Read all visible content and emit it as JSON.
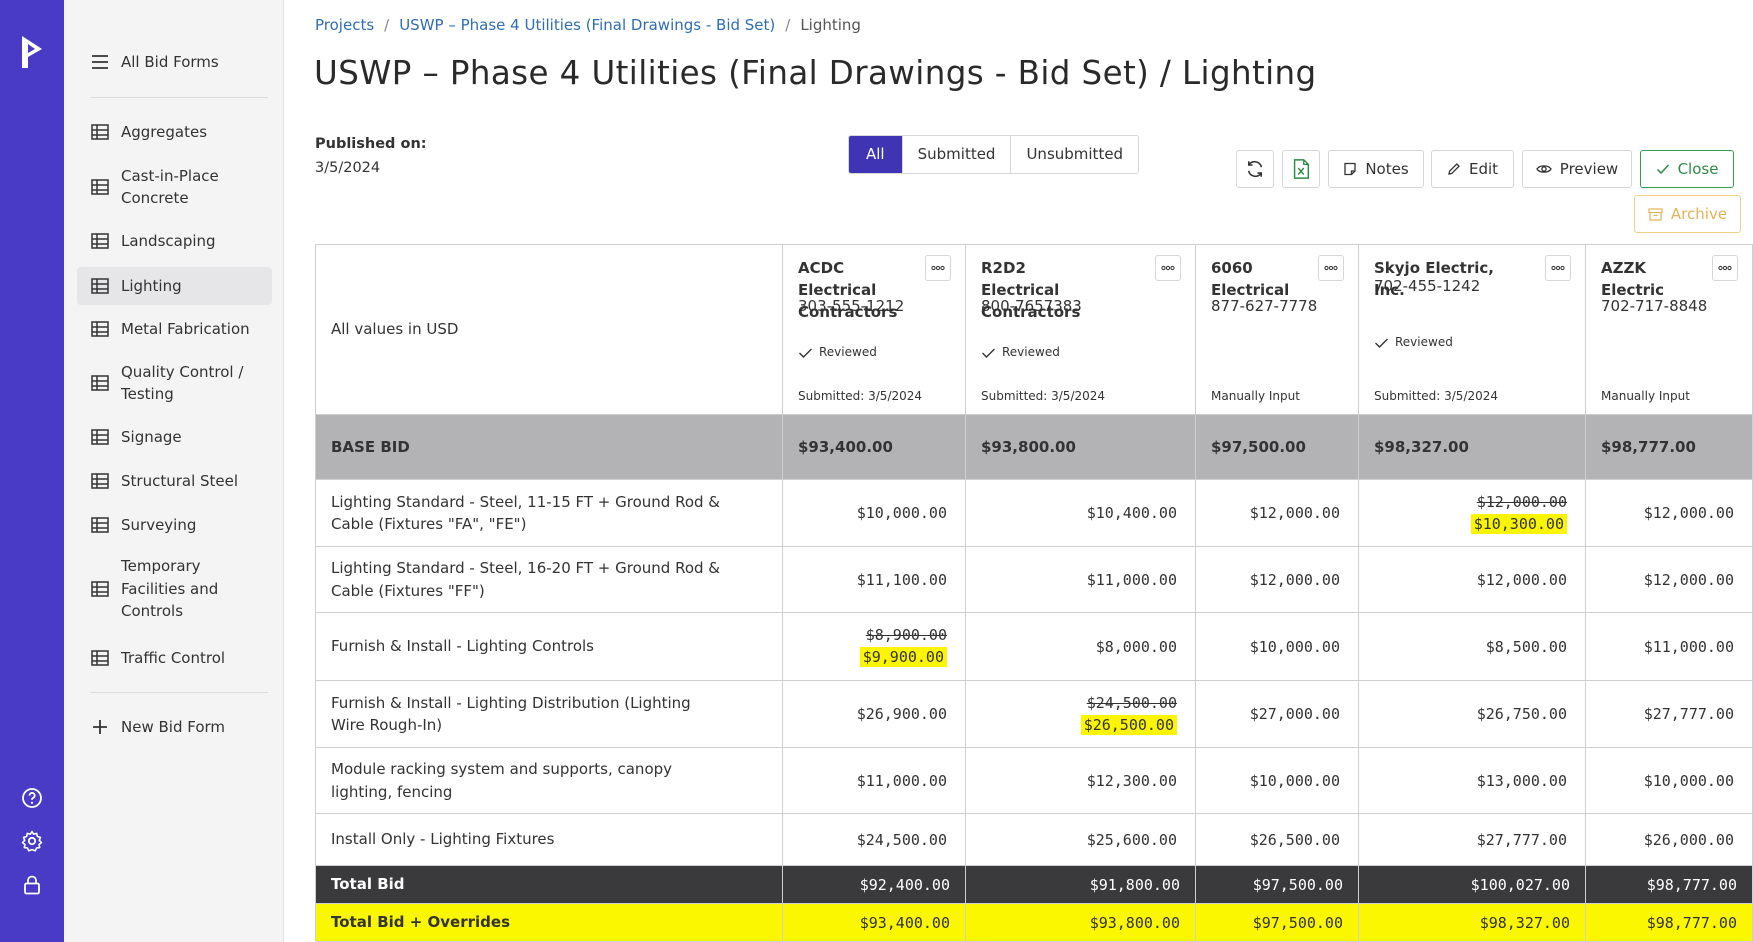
{
  "sidebar": {
    "all_bid_forms": "All Bid Forms",
    "items": [
      {
        "label": "Aggregates"
      },
      {
        "label": "Cast-in-Place Concrete"
      },
      {
        "label": "Landscaping"
      },
      {
        "label": "Lighting"
      },
      {
        "label": "Metal Fabrication"
      },
      {
        "label": "Quality Control / Testing"
      },
      {
        "label": "Signage"
      },
      {
        "label": "Structural Steel"
      },
      {
        "label": "Surveying"
      },
      {
        "label": "Temporary Facilities and Controls"
      },
      {
        "label": "Traffic Control"
      }
    ],
    "new_bid_form": "New Bid Form"
  },
  "breadcrumb": {
    "projects": "Projects",
    "project": "USWP – Phase 4 Utilities (Final Drawings - Bid Set)",
    "current": "Lighting"
  },
  "page_title": "USWP – Phase 4 Utilities (Final Drawings - Bid Set) / Lighting",
  "published": {
    "label": "Published on:",
    "date": "3/5/2024"
  },
  "filters": {
    "all": "All",
    "submitted": "Submitted",
    "unsubmitted": "Unsubmitted"
  },
  "toolbar": {
    "notes": "Notes",
    "edit": "Edit",
    "preview": "Preview",
    "close": "Close",
    "archive": "Archive"
  },
  "table": {
    "header_note": "All values in USD",
    "bidders": [
      {
        "name": "ACDC Electrical Contractors",
        "phone": "303-555-1212",
        "reviewed": "Reviewed",
        "status": "Submitted: 3/5/2024"
      },
      {
        "name": "R2D2 Electrical Contractors",
        "phone": "800-7657383",
        "reviewed": "Reviewed",
        "status": "Submitted: 3/5/2024"
      },
      {
        "name": "6060 Electrical",
        "phone": "877-627-7778",
        "reviewed": "",
        "status": "Manually Input"
      },
      {
        "name": "Skyjo Electric, Inc.",
        "phone": "702-455-1242",
        "reviewed": "Reviewed",
        "status": "Submitted: 3/5/2024"
      },
      {
        "name": "AZZK Electric",
        "phone": "702-717-8848",
        "reviewed": "",
        "status": "Manually Input"
      }
    ],
    "base_bid": {
      "label": "BASE BID",
      "values": [
        "$93,400.00",
        "$93,800.00",
        "$97,500.00",
        "$98,327.00",
        "$98,777.00"
      ]
    },
    "rows": [
      {
        "label": "Lighting Standard - Steel, 11-15 FT + Ground Rod & Cable (Fixtures \"FA\", \"FE\")",
        "cells": [
          {
            "v": "$10,000.00"
          },
          {
            "v": "$10,400.00"
          },
          {
            "v": "$12,000.00"
          },
          {
            "v": "$12,000.00",
            "o": "$10,300.00"
          },
          {
            "v": "$12,000.00"
          }
        ]
      },
      {
        "label": "Lighting Standard - Steel, 16-20 FT + Ground Rod & Cable (Fixtures \"FF\")",
        "cells": [
          {
            "v": "$11,100.00"
          },
          {
            "v": "$11,000.00"
          },
          {
            "v": "$12,000.00"
          },
          {
            "v": "$12,000.00"
          },
          {
            "v": "$12,000.00"
          }
        ]
      },
      {
        "label": "Furnish & Install - Lighting Controls",
        "cells": [
          {
            "v": "$8,900.00",
            "o": "$9,900.00"
          },
          {
            "v": "$8,000.00"
          },
          {
            "v": "$10,000.00"
          },
          {
            "v": "$8,500.00"
          },
          {
            "v": "$11,000.00"
          }
        ]
      },
      {
        "label": "Furnish & Install - Lighting Distribution (Lighting Wire Rough-In)",
        "cells": [
          {
            "v": "$26,900.00"
          },
          {
            "v": "$24,500.00",
            "o": "$26,500.00"
          },
          {
            "v": "$27,000.00"
          },
          {
            "v": "$26,750.00"
          },
          {
            "v": "$27,777.00"
          }
        ]
      },
      {
        "label": "Module racking system and supports, canopy lighting, fencing",
        "cells": [
          {
            "v": "$11,000.00"
          },
          {
            "v": "$12,300.00"
          },
          {
            "v": "$10,000.00"
          },
          {
            "v": "$13,000.00"
          },
          {
            "v": "$10,000.00"
          }
        ]
      },
      {
        "label": "Install Only - Lighting Fixtures",
        "cells": [
          {
            "v": "$24,500.00"
          },
          {
            "v": "$25,600.00"
          },
          {
            "v": "$26,500.00"
          },
          {
            "v": "$27,777.00"
          },
          {
            "v": "$26,000.00"
          }
        ]
      }
    ],
    "total_bid": {
      "label": "Total Bid",
      "values": [
        "$92,400.00",
        "$91,800.00",
        "$97,500.00",
        "$100,027.00",
        "$98,777.00"
      ]
    },
    "total_overrides": {
      "label": "Total Bid + Overrides",
      "values": [
        "$93,400.00",
        "$93,800.00",
        "$97,500.00",
        "$98,327.00",
        "$98,777.00"
      ]
    }
  },
  "colors": {
    "rail": "#4a3bc7",
    "accent": "#3f34b4",
    "override_highlight": "#fbf500",
    "link": "#2f6db5"
  }
}
